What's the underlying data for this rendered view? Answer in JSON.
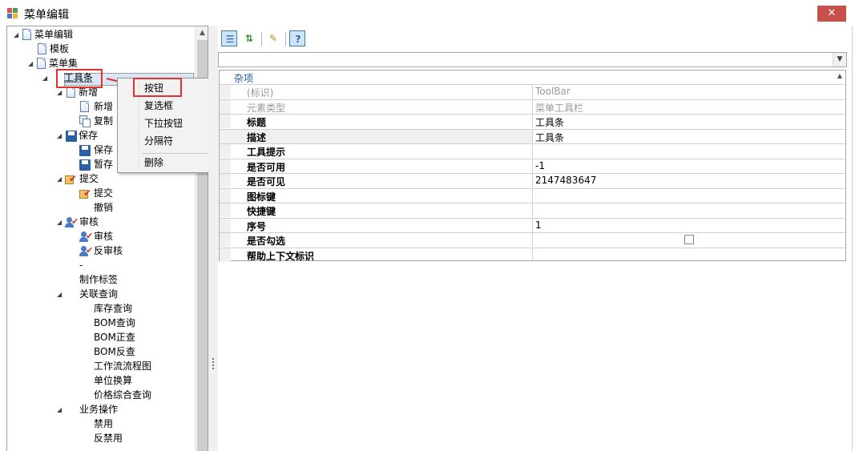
{
  "window": {
    "title": "菜单编辑",
    "close_label": "✕"
  },
  "tree": {
    "nodes": [
      {
        "label": "菜单编辑",
        "expander": "◢",
        "icon": "document-icon"
      },
      {
        "label": "模板",
        "expander": "",
        "icon": "document-icon"
      },
      {
        "label": "菜单集",
        "expander": "◢",
        "icon": "document-icon"
      },
      {
        "label": "工具条",
        "expander": "◢",
        "icon": ""
      },
      {
        "label": "新增",
        "expander": "◢",
        "icon": "document-icon"
      },
      {
        "label": "新增",
        "expander": "",
        "icon": "document-icon"
      },
      {
        "label": "复制",
        "expander": "",
        "icon": "copy-icon"
      },
      {
        "label": "保存",
        "expander": "◢",
        "icon": "save-icon"
      },
      {
        "label": "保存",
        "expander": "",
        "icon": "save-icon"
      },
      {
        "label": "暂存",
        "expander": "",
        "icon": "save-icon"
      },
      {
        "label": "提交",
        "expander": "◢",
        "icon": "submit-icon"
      },
      {
        "label": "提交",
        "expander": "",
        "icon": "submit-icon"
      },
      {
        "label": "撤销",
        "expander": "",
        "icon": ""
      },
      {
        "label": "审核",
        "expander": "◢",
        "icon": "audit-icon"
      },
      {
        "label": "审核",
        "expander": "",
        "icon": "audit-icon"
      },
      {
        "label": "反审核",
        "expander": "",
        "icon": "audit-icon"
      },
      {
        "label": "-",
        "expander": "",
        "icon": ""
      },
      {
        "label": "制作标签",
        "expander": "",
        "icon": ""
      },
      {
        "label": "关联查询",
        "expander": "◢",
        "icon": ""
      },
      {
        "label": "库存查询",
        "expander": "",
        "icon": ""
      },
      {
        "label": "BOM查询",
        "expander": "",
        "icon": ""
      },
      {
        "label": "BOM正查",
        "expander": "",
        "icon": ""
      },
      {
        "label": "BOM反查",
        "expander": "",
        "icon": ""
      },
      {
        "label": "工作流流程图",
        "expander": "",
        "icon": ""
      },
      {
        "label": "单位换算",
        "expander": "",
        "icon": ""
      },
      {
        "label": "价格综合查询",
        "expander": "",
        "icon": ""
      },
      {
        "label": "业务操作",
        "expander": "◢",
        "icon": ""
      },
      {
        "label": "禁用",
        "expander": "",
        "icon": ""
      },
      {
        "label": "反禁用",
        "expander": "",
        "icon": ""
      }
    ]
  },
  "context_menu": {
    "items": [
      "按钮",
      "复选框",
      "下拉按钮",
      "分隔符",
      "删除"
    ]
  },
  "toolbar": {
    "buttons": [
      "categorized-icon",
      "sort-alpha-icon",
      "property-pages-icon",
      "help-icon"
    ]
  },
  "property_grid": {
    "category": "杂项",
    "rows": [
      {
        "name": "(标识)",
        "value": "ToolBar",
        "readonly": true
      },
      {
        "name": "元素类型",
        "value": "菜单工具栏",
        "readonly": true
      },
      {
        "name": "标题",
        "value": "工具条",
        "readonly": false
      },
      {
        "name": "描述",
        "value": "工具条",
        "readonly": false
      },
      {
        "name": "工具提示",
        "value": "",
        "readonly": false
      },
      {
        "name": "是否可用",
        "value": "-1",
        "readonly": false
      },
      {
        "name": "是否可见",
        "value": "2147483647",
        "readonly": false
      },
      {
        "name": "图标键",
        "value": "",
        "readonly": false
      },
      {
        "name": "快捷键",
        "value": "",
        "readonly": false
      },
      {
        "name": "序号",
        "value": "1",
        "readonly": false
      },
      {
        "name": "是否勾选",
        "value": "",
        "readonly": false
      },
      {
        "name": "帮助上下文标识",
        "value": "",
        "readonly": false
      }
    ]
  },
  "colors": {
    "accent": "#1e5aa8",
    "annotation_red": "#e0312b",
    "close_red": "#c7504b"
  }
}
